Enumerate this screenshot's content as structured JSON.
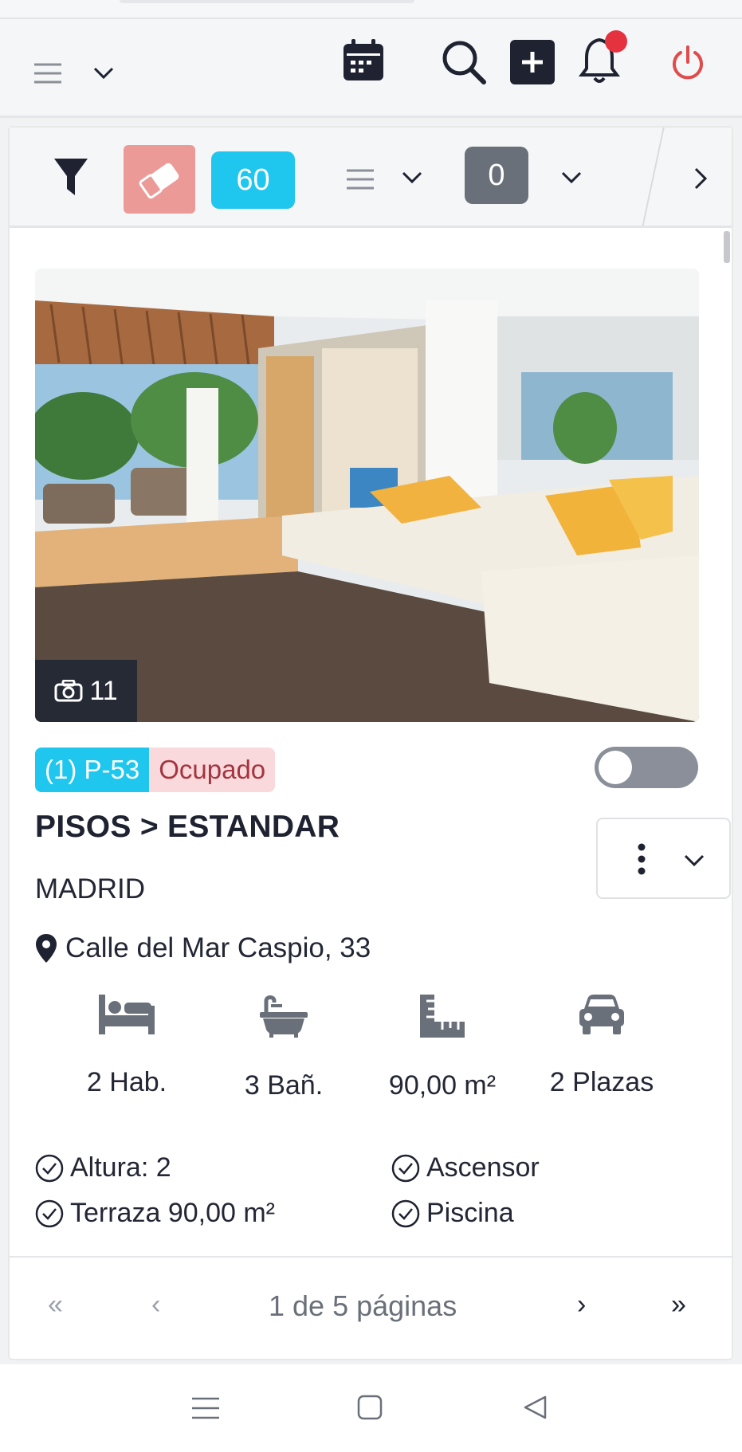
{
  "toolbar": {
    "icons": [
      "menu-icon",
      "chevron-down-icon",
      "calendar-icon",
      "search-icon",
      "plus-icon",
      "bell-icon",
      "power-icon"
    ],
    "notification_dot_color": "#e5323f",
    "power_color": "#e04b4b"
  },
  "filters": {
    "filter_icon": "filter-icon",
    "eraser_icon": "eraser-icon",
    "count_badge": "60",
    "count_badge_color": "#1fc6ee",
    "selection_badge": "0",
    "selection_badge_color": "#6a7079"
  },
  "listing": {
    "photo_count": "11",
    "reference": "(1) P-53",
    "status": "Ocupado",
    "title": "PISOS > ESTANDAR",
    "city": "MADRID",
    "address": "Calle del Mar Caspio, 33",
    "features": [
      {
        "icon": "bed-icon",
        "label": "2 Hab."
      },
      {
        "icon": "bath-icon",
        "label": "3 Bañ."
      },
      {
        "icon": "ruler-icon",
        "label": "90,00 m²"
      },
      {
        "icon": "car-icon",
        "label": "2 Plazas"
      }
    ],
    "extras": [
      "Altura: 2",
      "Ascensor",
      "Terraza 90,00 m²",
      "Piscina"
    ]
  },
  "pagination": {
    "first": "«",
    "prev": "‹",
    "info": "1 de 5 páginas",
    "next": "›",
    "last": "»"
  },
  "system_nav": [
    "recents-icon",
    "home-icon",
    "back-icon"
  ]
}
